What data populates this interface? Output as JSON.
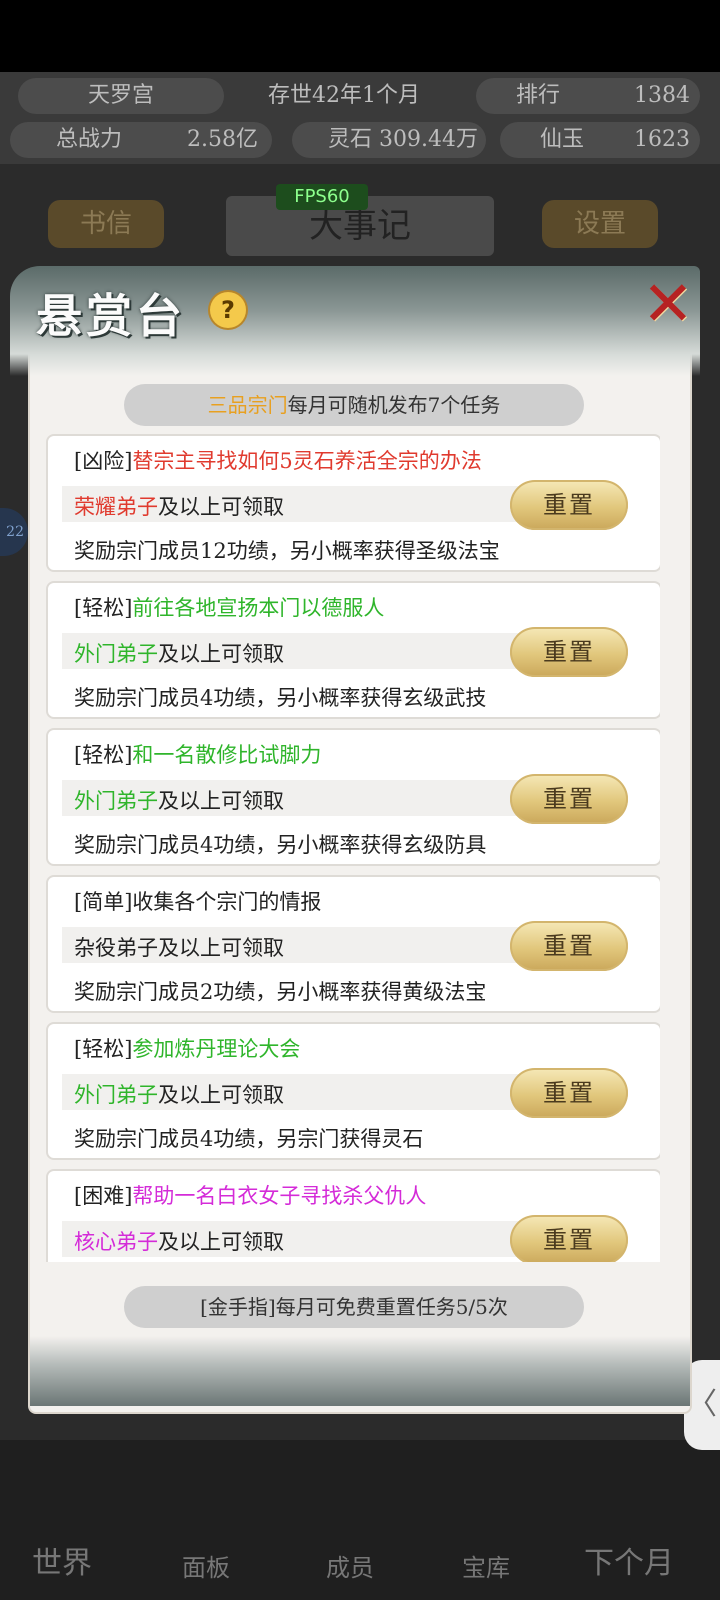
{
  "header": {
    "sect_name": "天罗宫",
    "time": "存世42年1个月",
    "rank_label": "排行",
    "rank_value": "1384",
    "power_label": "总战力",
    "power_value": "2.58亿",
    "spirit_stone_label": "灵石",
    "spirit_stone_value": "309.44万",
    "jade_label": "仙玉",
    "jade_value": "1623"
  },
  "background": {
    "letters_button": "书信",
    "chronicle_title": "大事记",
    "settings_button": "设置",
    "fps": "FPS60",
    "side_badge": "22",
    "side_tab": "〈"
  },
  "bottom_nav": {
    "items": [
      "世界",
      "面板",
      "成员",
      "宝库",
      "下个月"
    ]
  },
  "modal": {
    "title": "悬赏台",
    "help": "?",
    "close": "✕",
    "banner_highlight": "三品宗门",
    "banner_text": "每月可随机发布7个任务",
    "reset_label": "重置",
    "footer": "[金手指]每月可免费重置任务5/5次",
    "tasks": [
      {
        "difficulty": "[凶险]",
        "name": "替宗主寻找如何5灵石养活全宗的办法",
        "name_color": "#e03a2e",
        "rank": "荣耀弟子",
        "rank_color": "#e03a2e",
        "requirement_suffix": "及以上可领取",
        "reward": "奖励宗门成员12功绩，另小概率获得圣级法宝"
      },
      {
        "difficulty": "[轻松]",
        "name": "前往各地宣扬本门以德服人",
        "name_color": "#2fb52b",
        "rank": "外门弟子",
        "rank_color": "#2fb52b",
        "requirement_suffix": "及以上可领取",
        "reward": "奖励宗门成员4功绩，另小概率获得玄级武技"
      },
      {
        "difficulty": "[轻松]",
        "name": "和一名散修比试脚力",
        "name_color": "#2fb52b",
        "rank": "外门弟子",
        "rank_color": "#2fb52b",
        "requirement_suffix": "及以上可领取",
        "reward": "奖励宗门成员4功绩，另小概率获得玄级防具"
      },
      {
        "difficulty": "[简单]",
        "name": "收集各个宗门的情报",
        "name_color": "#222222",
        "rank": "杂役弟子",
        "rank_color": "#222222",
        "requirement_suffix": "及以上可领取",
        "reward": "奖励宗门成员2功绩，另小概率获得黄级法宝"
      },
      {
        "difficulty": "[轻松]",
        "name": "参加炼丹理论大会",
        "name_color": "#2fb52b",
        "rank": "外门弟子",
        "rank_color": "#2fb52b",
        "requirement_suffix": "及以上可领取",
        "reward": "奖励宗门成员4功绩，另宗门获得灵石"
      },
      {
        "difficulty": "[困难]",
        "name": "帮助一名白衣女子寻找杀父仇人",
        "name_color": "#d42bd8",
        "rank": "核心弟子",
        "rank_color": "#d42bd8",
        "requirement_suffix": "及以上可领取",
        "reward": ""
      }
    ]
  }
}
